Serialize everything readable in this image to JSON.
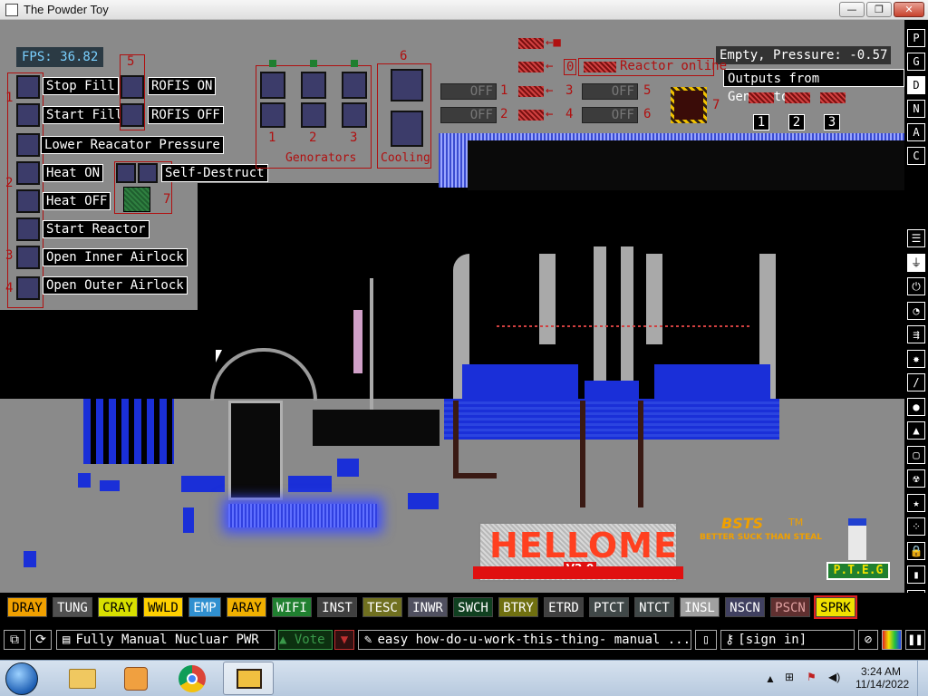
{
  "window": {
    "title": "The Powder Toy",
    "btn_min": "—",
    "btn_max": "❐",
    "btn_close": "✕"
  },
  "hud": {
    "fps": "FPS: 36.82",
    "pressure": "Empty, Pressure: -0.57",
    "outputs": "Outputs from Genorators."
  },
  "controls": {
    "stop_fill": "Stop Fill",
    "start_fill": "Start Fill",
    "rofis_on": "ROFIS ON",
    "rofis_off": "ROFIS OFF",
    "lower_pressure": "Lower Reacator Pressure",
    "heat_on": "Heat ON",
    "heat_off": "Heat OFF",
    "self_destruct": "Self-Destruct",
    "start_reactor": "Start Reactor",
    "open_inner": "Open Inner Airlock",
    "open_outer": "Open Outer Airlock"
  },
  "labels": {
    "n1": "1",
    "n2": "2",
    "n3": "3",
    "n4": "4",
    "n5": "5",
    "n6": "6",
    "n7": "7",
    "generators": "Genorators",
    "cooling": "Cooling",
    "reactor_online": "Reactor online",
    "zero": "0",
    "off": "OFF",
    "o1": "1",
    "o2": "2",
    "o3": "3",
    "logo_main": "HELLOME",
    "logo_ver": "V2.0",
    "bsts": "BSTS",
    "bsts_tm": "TM",
    "bsts_sub": "BETTER SUCK THAN STEAL",
    "pteg": "P.T.E.G"
  },
  "side_tools": [
    "P",
    "G",
    "D",
    "N",
    "A",
    "C"
  ],
  "side_tools_selected": 2,
  "side_icons": [
    "menu-icon",
    "plug-icon",
    "power-icon",
    "gauge-icon",
    "sensor-icon",
    "explosive-icon",
    "pen-icon",
    "drop-icon",
    "flask-icon",
    "square-icon",
    "radiation-icon",
    "star-icon",
    "dots-icon",
    "lock-icon",
    "bookmark-icon",
    "pointer-icon"
  ],
  "elements": [
    {
      "label": "DRAY",
      "bg": "#f0a000",
      "fg": "#000"
    },
    {
      "label": "TUNG",
      "bg": "#505050",
      "fg": "#fff"
    },
    {
      "label": "CRAY",
      "bg": "#d8e000",
      "fg": "#000"
    },
    {
      "label": "WWLD",
      "bg": "#ffd000",
      "fg": "#000"
    },
    {
      "label": "EMP",
      "bg": "#3090d0",
      "fg": "#fff"
    },
    {
      "label": "ARAY",
      "bg": "#f0b000",
      "fg": "#000"
    },
    {
      "label": "WIFI",
      "bg": "#208030",
      "fg": "#fff"
    },
    {
      "label": "INST",
      "bg": "#404040",
      "fg": "#fff"
    },
    {
      "label": "TESC",
      "bg": "#707020",
      "fg": "#fff"
    },
    {
      "label": "INWR",
      "bg": "#505060",
      "fg": "#fff"
    },
    {
      "label": "SWCH",
      "bg": "#104020",
      "fg": "#fff"
    },
    {
      "label": "BTRY",
      "bg": "#707010",
      "fg": "#fff"
    },
    {
      "label": "ETRD",
      "bg": "#404040",
      "fg": "#fff"
    },
    {
      "label": "PTCT",
      "bg": "#404848",
      "fg": "#fff"
    },
    {
      "label": "NTCT",
      "bg": "#404848",
      "fg": "#fff"
    },
    {
      "label": "INSL",
      "bg": "#a0a0a0",
      "fg": "#fff"
    },
    {
      "label": "NSCN",
      "bg": "#404060",
      "fg": "#fff"
    },
    {
      "label": "PSCN",
      "bg": "#603030",
      "fg": "#e0a0a0"
    },
    {
      "label": "SPRK",
      "bg": "#f0e000",
      "fg": "#000"
    }
  ],
  "bottom": {
    "save_name": "Fully Manual Nucluar PWR",
    "vote": "Vote",
    "tags": "easy how-do-u-work-this-thing- manual ...",
    "signin": "[sign in]"
  },
  "taskbar": {
    "time": "3:24 AM",
    "date": "11/14/2022"
  }
}
